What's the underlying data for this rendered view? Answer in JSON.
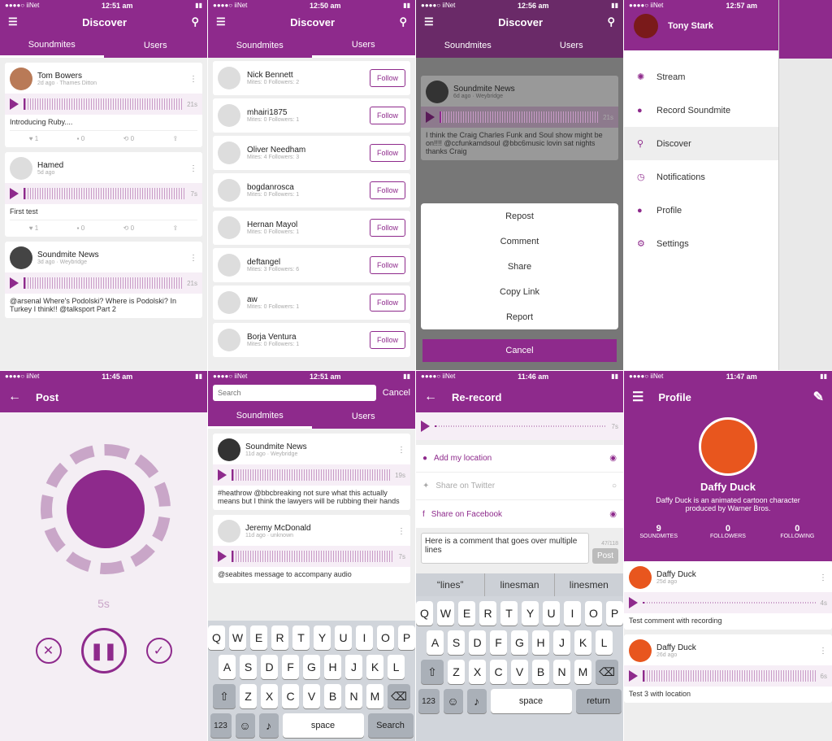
{
  "status": {
    "carrier": "●●●●○ iiNet",
    "t1": "12:51 am",
    "t2": "12:50 am",
    "t3": "12:56 am",
    "t4": "12:57 am",
    "t5": "11:45 am",
    "t6": "12:51 am",
    "t7": "11:46 am",
    "t8": "11:47 am"
  },
  "discover": {
    "title": "Discover",
    "tab1": "Soundmites",
    "tab2": "Users"
  },
  "feed": [
    {
      "name": "Tom Bowers",
      "sub": "2d ago · Thames Ditton",
      "dur": "21s",
      "text": "Introducing Ruby....",
      "likes": "1",
      "comments": "0",
      "reposts": "0"
    },
    {
      "name": "Hamed",
      "sub": "5d ago",
      "dur": "7s",
      "text": "First test",
      "likes": "1",
      "comments": "0",
      "reposts": "0"
    },
    {
      "name": "Soundmite News",
      "sub": "3d ago · Weybridge",
      "dur": "21s",
      "text": "@arsenal Where's Podolski? Where is Podolski? In Turkey I think!! @talksport Part 2"
    }
  ],
  "users": [
    {
      "name": "Nick Bennett",
      "stats": "Mites: 0   Followers: 2"
    },
    {
      "name": "mhairi1875",
      "stats": "Mites: 0   Followers: 1"
    },
    {
      "name": "Oliver Needham",
      "stats": "Mites: 4   Followers: 3"
    },
    {
      "name": "bogdanrosca",
      "stats": "Mites: 0   Followers: 1"
    },
    {
      "name": "Hernan Mayol",
      "stats": "Mites: 0   Followers: 1"
    },
    {
      "name": "deftangel",
      "stats": "Mites: 3   Followers: 6"
    },
    {
      "name": "aw",
      "stats": "Mites: 0   Followers: 1"
    },
    {
      "name": "Borja Ventura",
      "stats": "Mites: 0   Followers: 1"
    }
  ],
  "follow": "Follow",
  "actionsheet": {
    "post_name": "Soundmite News",
    "post_sub": "6d ago · Weybridge",
    "post_dur": "21s",
    "post_text": "I think the Craig Charles Funk and Soul show might be on!!!! @ccfunkamdsoul @bbc6music lovin sat nights thanks Craig",
    "items": [
      "Repost",
      "Comment",
      "Share",
      "Copy Link",
      "Report"
    ],
    "cancel": "Cancel"
  },
  "drawer": {
    "user": "Tony Stark",
    "items": [
      "Stream",
      "Record Soundmite",
      "Discover",
      "Notifications",
      "Profile",
      "Settings"
    ]
  },
  "post": {
    "title": "Post",
    "time": "5s"
  },
  "search": {
    "placeholder": "Search",
    "cancel": "Cancel",
    "result1": {
      "name": "Soundmite News",
      "sub": "11d ago · Weybridge",
      "dur": "19s",
      "text": "#heathrow @bbcbreaking not sure what this actually means but I think the lawyers will be rubbing their hands"
    },
    "result2": {
      "name": "Jeremy  McDonald",
      "sub": "11d ago · unknown",
      "dur": "7s",
      "text": "@seabites message to accompany audio"
    }
  },
  "rerecord": {
    "title": "Re-record",
    "dur": "7s",
    "opt1": "Add my location",
    "opt2": "Share on Twitter",
    "opt3": "Share on Facebook",
    "comment": "Here is a comment that goes over multiple lines",
    "count": "47/118",
    "post": "Post",
    "sugg": [
      "“lines”",
      "linesman",
      "linesmen"
    ]
  },
  "keyboard": {
    "row1": [
      "Q",
      "W",
      "E",
      "R",
      "T",
      "Y",
      "U",
      "I",
      "O",
      "P"
    ],
    "row2": [
      "A",
      "S",
      "D",
      "F",
      "G",
      "H",
      "J",
      "K",
      "L"
    ],
    "row3": [
      "Z",
      "X",
      "C",
      "V",
      "B",
      "N",
      "M"
    ],
    "num": "123",
    "space": "space",
    "search": "Search",
    "ret": "return"
  },
  "profile": {
    "title": "Profile",
    "name": "Daffy Duck",
    "bio": "Daffy Duck is an animated cartoon character produced by Warner Bros.",
    "stats": [
      {
        "n": "9",
        "l": "SOUNDMITES"
      },
      {
        "n": "0",
        "l": "FOLLOWERS"
      },
      {
        "n": "0",
        "l": "FOLLOWING"
      }
    ],
    "posts": [
      {
        "sub": "25d ago",
        "dur": "4s",
        "text": "Test comment with recording"
      },
      {
        "sub": "26d ago",
        "dur": "6s",
        "text": "Test 3 with location"
      }
    ]
  }
}
